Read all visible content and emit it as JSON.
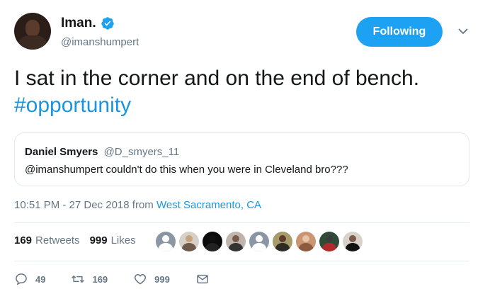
{
  "author": {
    "display_name": "Iman.",
    "handle": "@imanshumpert",
    "verified_icon": "verified-badge-icon",
    "avatar_icon": "profile-avatar"
  },
  "follow_button": {
    "label": "Following"
  },
  "menu": {
    "icon": "chevron-down-icon"
  },
  "tweet": {
    "text": "I sat in the corner and on the end of bench.",
    "hashtag": "#opportunity"
  },
  "quote": {
    "name": "Daniel Smyers",
    "handle": "@D_smyers_11",
    "text": "@imanshumpert couldn't do this when you were in Cleveland bro???"
  },
  "meta": {
    "time": "10:51 PM - 27 Dec 2018",
    "from_label": "from",
    "location": "West Sacramento, CA"
  },
  "stats": {
    "retweets_count": "169",
    "retweets_label": "Retweets",
    "likes_count": "999",
    "likes_label": "Likes"
  },
  "likers": [
    {
      "head": "#ffffff",
      "body": "#ffffff",
      "bg": "#8a96a3"
    },
    {
      "head": "#c8a27c",
      "body": "#6d5a4a",
      "bg": "#d5d0c8"
    },
    {
      "head": "#111111",
      "body": "#222222",
      "bg": "#0c0c0c"
    },
    {
      "head": "#7a5a48",
      "body": "#333333",
      "bg": "#bfb5ad"
    },
    {
      "head": "#ffffff",
      "body": "#ffffff",
      "bg": "#8a96a3"
    },
    {
      "head": "#5e3d2d",
      "body": "#2e2b24",
      "bg": "#a79b6b"
    },
    {
      "head": "#e6c3a6",
      "body": "#8b5b3e",
      "bg": "#c99572"
    },
    {
      "head": "#3c3c3c",
      "body": "#b02c2c",
      "bg": "#2f4d36"
    },
    {
      "head": "#7a5a48",
      "body": "#111111",
      "bg": "#d8d2cb"
    }
  ],
  "actions": {
    "reply_count": "49",
    "retweet_count": "169",
    "like_count": "999"
  },
  "colors": {
    "accent": "#1da1f2",
    "link": "#1b95e0",
    "secondary_text": "#657786",
    "border": "#e1e8ed"
  }
}
